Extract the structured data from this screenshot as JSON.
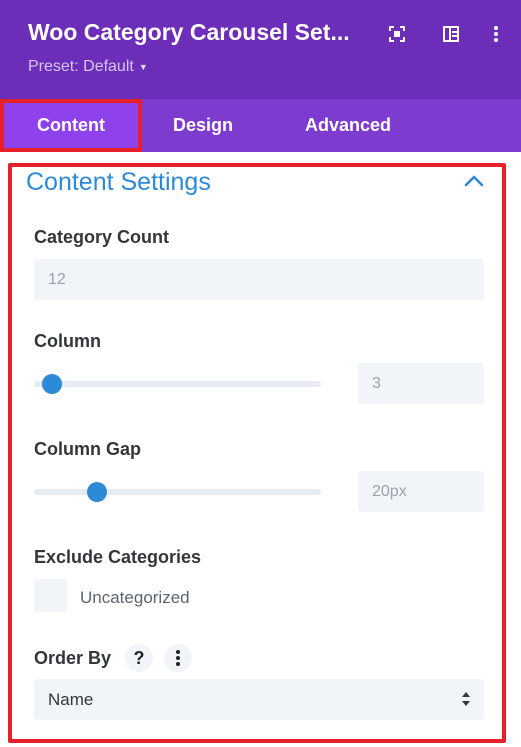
{
  "header": {
    "title": "Woo Category Carousel Set...",
    "preset_label": "Preset: Default",
    "icons": [
      "expand-icon",
      "sidebar-layout-icon",
      "more-vertical-icon"
    ]
  },
  "tabs": [
    {
      "label": "Content",
      "active": true
    },
    {
      "label": "Design",
      "active": false
    },
    {
      "label": "Advanced",
      "active": false
    }
  ],
  "content_settings": {
    "title": "Content Settings",
    "category_count": {
      "label": "Category Count",
      "value": "12"
    },
    "column": {
      "label": "Column",
      "value": "3"
    },
    "column_gap": {
      "label": "Column Gap",
      "value": "20px"
    },
    "exclude_categories": {
      "label": "Exclude Categories",
      "options": [
        {
          "label": "Uncategorized",
          "checked": false
        }
      ]
    },
    "order_by": {
      "label": "Order By",
      "help": "?",
      "value": "Name"
    }
  },
  "colors": {
    "header_bg": "#6c2eb9",
    "tabs_bg": "#7e3bd0",
    "active_tab_bg": "#8f42ec",
    "accent_blue": "#2c8ad6",
    "highlight_red": "#e8202a"
  }
}
